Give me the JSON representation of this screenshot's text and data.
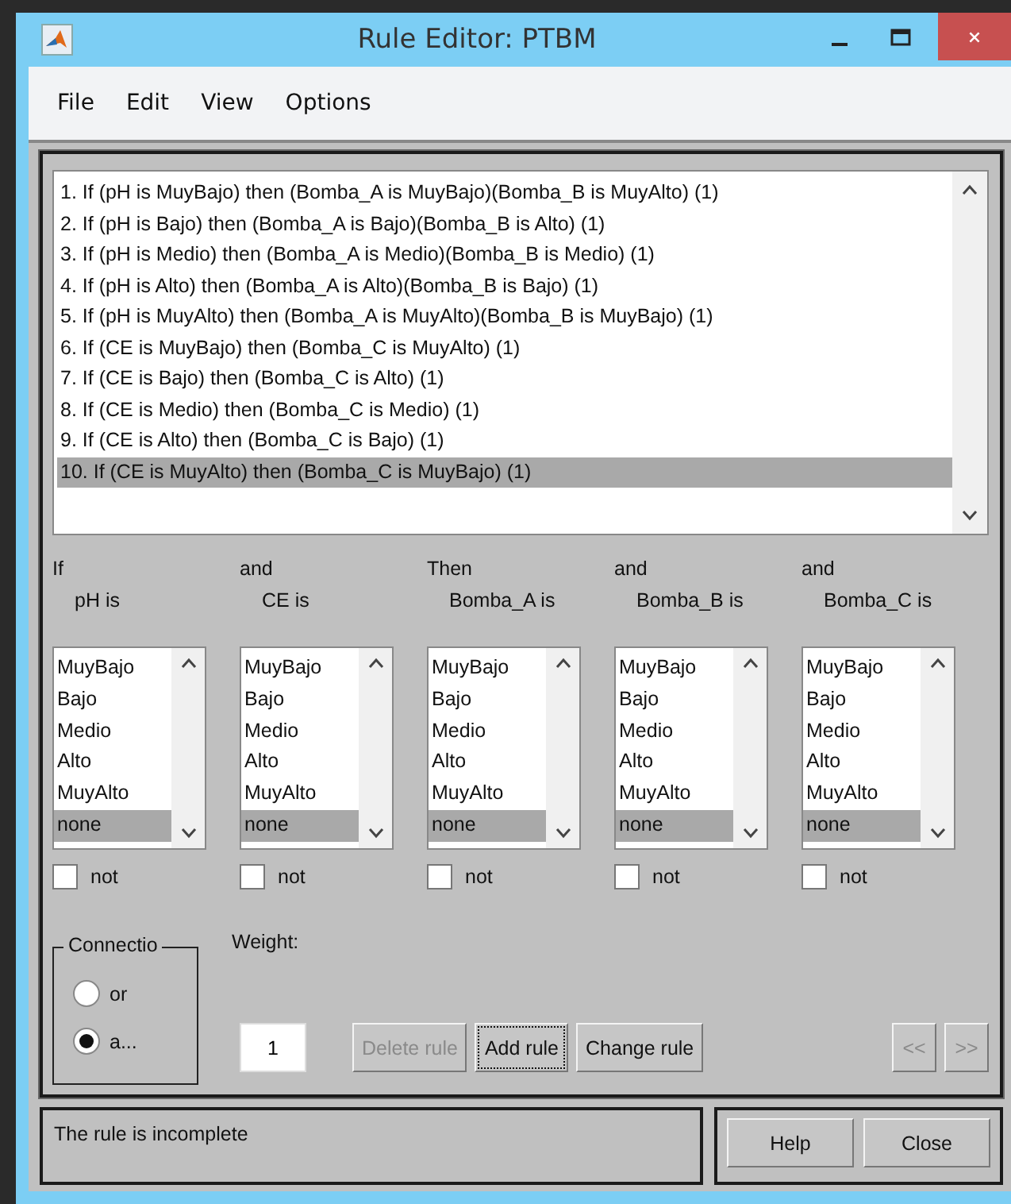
{
  "window": {
    "title": "Rule Editor: PTBM"
  },
  "menu": [
    "File",
    "Edit",
    "View",
    "Options"
  ],
  "rules": [
    {
      "text": "1. If (pH is MuyBajo) then (Bomba_A is MuyBajo)(Bomba_B is MuyAlto) (1)",
      "selected": false
    },
    {
      "text": "2. If (pH is Bajo) then (Bomba_A is Bajo)(Bomba_B is Alto) (1)",
      "selected": false
    },
    {
      "text": "3. If (pH is Medio) then (Bomba_A is Medio)(Bomba_B is Medio) (1)",
      "selected": false
    },
    {
      "text": "4. If (pH is Alto) then (Bomba_A is Alto)(Bomba_B is Bajo) (1)",
      "selected": false
    },
    {
      "text": "5. If (pH is MuyAlto) then (Bomba_A is MuyAlto)(Bomba_B is MuyBajo) (1)",
      "selected": false
    },
    {
      "text": "6. If (CE is MuyBajo) then (Bomba_C is MuyAlto) (1)",
      "selected": false
    },
    {
      "text": "7. If (CE is Bajo) then (Bomba_C is Alto) (1)",
      "selected": false
    },
    {
      "text": "8. If (CE is Medio) then (Bomba_C is Medio) (1)",
      "selected": false
    },
    {
      "text": "9. If (CE is Alto) then (Bomba_C is Bajo) (1)",
      "selected": false
    },
    {
      "text": "10. If (CE is MuyAlto) then (Bomba_C is MuyBajo) (1)",
      "selected": true
    }
  ],
  "columns": [
    {
      "connector": "If",
      "variable": "pH is",
      "options": [
        {
          "label": "MuyBajo",
          "selected": false
        },
        {
          "label": "Bajo",
          "selected": false
        },
        {
          "label": "Medio",
          "selected": false
        },
        {
          "label": "Alto",
          "selected": false
        },
        {
          "label": "MuyAlto",
          "selected": false
        },
        {
          "label": "none",
          "selected": true
        }
      ],
      "not_label": "not",
      "not_checked": false
    },
    {
      "connector": "and",
      "variable": "CE is",
      "options": [
        {
          "label": "MuyBajo",
          "selected": false
        },
        {
          "label": "Bajo",
          "selected": false
        },
        {
          "label": "Medio",
          "selected": false
        },
        {
          "label": "Alto",
          "selected": false
        },
        {
          "label": "MuyAlto",
          "selected": false
        },
        {
          "label": "none",
          "selected": true
        }
      ],
      "not_label": "not",
      "not_checked": false
    },
    {
      "connector": "Then",
      "variable": "Bomba_A is",
      "options": [
        {
          "label": "MuyBajo",
          "selected": false
        },
        {
          "label": "Bajo",
          "selected": false
        },
        {
          "label": "Medio",
          "selected": false
        },
        {
          "label": "Alto",
          "selected": false
        },
        {
          "label": "MuyAlto",
          "selected": false
        },
        {
          "label": "none",
          "selected": true
        }
      ],
      "not_label": "not",
      "not_checked": false
    },
    {
      "connector": "and",
      "variable": "Bomba_B is",
      "options": [
        {
          "label": "MuyBajo",
          "selected": false
        },
        {
          "label": "Bajo",
          "selected": false
        },
        {
          "label": "Medio",
          "selected": false
        },
        {
          "label": "Alto",
          "selected": false
        },
        {
          "label": "MuyAlto",
          "selected": false
        },
        {
          "label": "none",
          "selected": true
        }
      ],
      "not_label": "not",
      "not_checked": false
    },
    {
      "connector": "and",
      "variable": "Bomba_C is",
      "options": [
        {
          "label": "MuyBajo",
          "selected": false
        },
        {
          "label": "Bajo",
          "selected": false
        },
        {
          "label": "Medio",
          "selected": false
        },
        {
          "label": "Alto",
          "selected": false
        },
        {
          "label": "MuyAlto",
          "selected": false
        },
        {
          "label": "none",
          "selected": true
        }
      ],
      "not_label": "not",
      "not_checked": false
    }
  ],
  "connection": {
    "title": "Connectio",
    "options": [
      {
        "label": "or",
        "selected": false
      },
      {
        "label": "a...",
        "selected": true
      }
    ]
  },
  "weight": {
    "label": "Weight:",
    "value": "1"
  },
  "buttons": [
    {
      "label": "Delete rule",
      "disabled": true,
      "focused": false
    },
    {
      "label": "Add rule",
      "disabled": false,
      "focused": true
    },
    {
      "label": "Change rule",
      "disabled": false,
      "focused": false
    }
  ],
  "nav_buttons": [
    {
      "label": "<<",
      "disabled": true
    },
    {
      "label": ">>",
      "disabled": true
    }
  ],
  "status": "The rule is incomplete",
  "footer_buttons": [
    "Help",
    "Close"
  ]
}
